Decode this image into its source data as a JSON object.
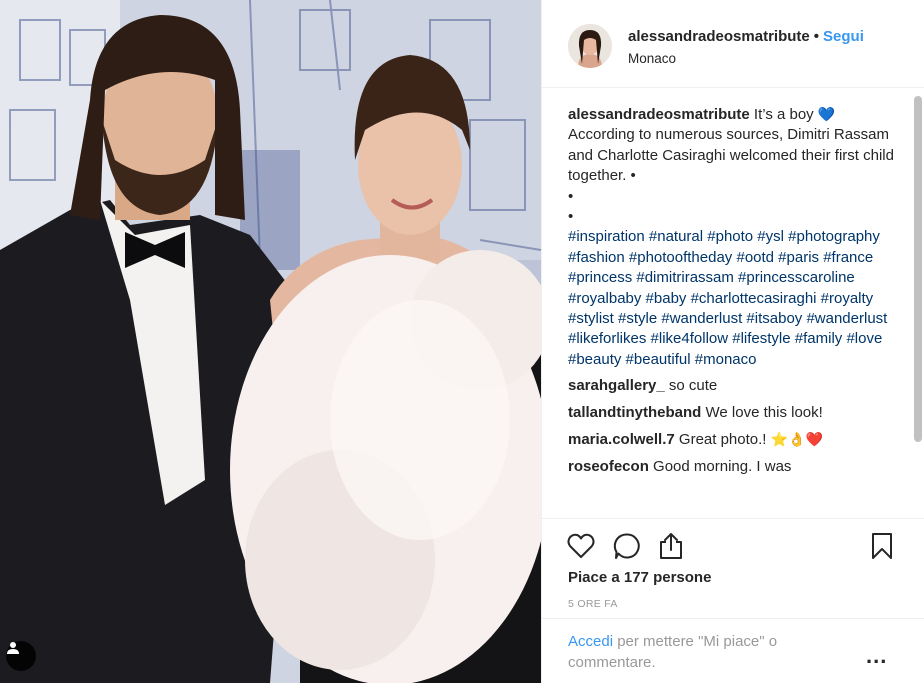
{
  "header": {
    "username": "alessandradeosmatribute",
    "separator": "•",
    "follow_label": "Segui",
    "location": "Monaco"
  },
  "caption": {
    "username": "alessandradeosmatribute",
    "text": "It’s a boy",
    "emoji": "💙",
    "body": "According to numerous sources, Dimitri Rassam and Charlotte Casiraghi welcomed their first child together. •",
    "bullet1": "•",
    "bullet2": "•",
    "hashtags": "#inspiration #natural #photo #ysl #photography #fashion #photooftheday #ootd #paris #france #princess #dimitrirassam #princesscaroline #royalbaby #baby #charlottecasiraghi #royalty #stylist #style #wanderlust #itsaboy #wanderlust #likeforlikes #like4follow #lifestyle #family #love #beauty #beautiful #monaco"
  },
  "comments": [
    {
      "user": "sarahgallery_",
      "text": "so cute"
    },
    {
      "user": "tallandtinytheband",
      "text": "We love this look!"
    },
    {
      "user": "maria.colwell.7",
      "text": "Great photo.!",
      "emoji": "⭐👌❤️"
    },
    {
      "user": "roseofecon",
      "text": "Good morning. I was"
    }
  ],
  "actions": {
    "icons": [
      "heart-icon",
      "comment-icon",
      "share-icon",
      "bookmark-icon"
    ],
    "likes": "Piace a 177 persone",
    "time": "5 ORE FA"
  },
  "login": {
    "link": "Accedi",
    "text": "per mettere \"Mi piace\" o commentare.",
    "more": "..."
  },
  "colors": {
    "link": "#3897f0",
    "hashtag": "#003569",
    "muted": "#999999"
  }
}
